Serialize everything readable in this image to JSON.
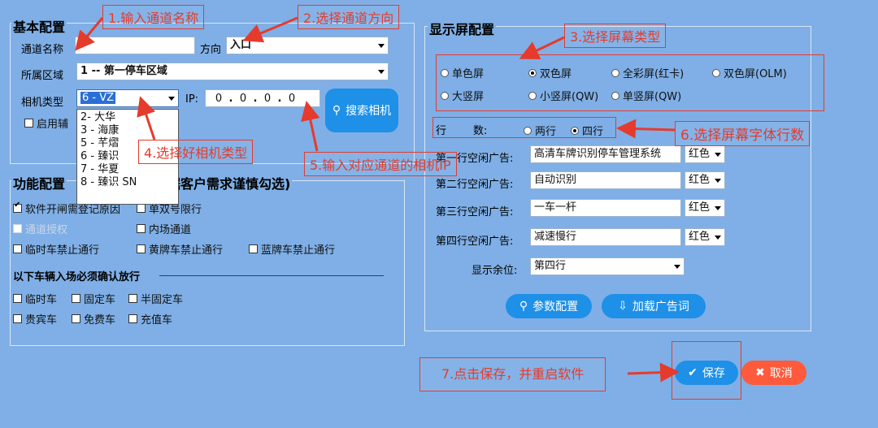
{
  "basic": {
    "title": "基本配置",
    "channel_name_label": "通道名称",
    "channel_name_value": "",
    "direction_label": "方向",
    "direction_value": "入口",
    "area_label": "所属区域",
    "area_value": "1 -- 第一停车区域",
    "camera_type_label": "相机类型",
    "camera_type_value": "6 -  VZ",
    "camera_options": [
      "2-   大华",
      "3 -  海康",
      "5 -  芊熠",
      "6 -  臻识",
      "7 -  华夏",
      "8 -  臻识 SN"
    ],
    "ip_label": "IP:",
    "ip_parts": [
      "0",
      "0",
      "0",
      "0"
    ],
    "search_camera_label": "搜索相机",
    "enable_aux_label": "启用辅"
  },
  "function": {
    "title_left": "功能配置",
    "title_right": "据客户需求谨慎勾选)",
    "options": [
      {
        "label": "软件开闸需登记原因",
        "checked": true
      },
      {
        "label": "单双号限行",
        "checked": false
      },
      {
        "label": "通道授权",
        "checked": false
      },
      {
        "label": "内场通道",
        "checked": false
      },
      {
        "label": "临时车禁止通行",
        "checked": false
      },
      {
        "label": "黄牌车禁止通行",
        "checked": false
      },
      {
        "label": "蓝牌车禁止通行",
        "checked": false
      }
    ],
    "confirm_title": "以下车辆入场必须确认放行",
    "confirm_options": [
      "临时车",
      "固定车",
      "半固定车",
      "贵宾车",
      "免费车",
      "充值车"
    ]
  },
  "display": {
    "title": "显示屏配置",
    "screen_types": [
      {
        "label": "单色屏",
        "on": false
      },
      {
        "label": "双色屏",
        "on": true
      },
      {
        "label": "全彩屏(红卡)",
        "on": false
      },
      {
        "label": "双色屏(OLM)",
        "on": false
      },
      {
        "label": "大竖屏",
        "on": false
      },
      {
        "label": "小竖屏(QW)",
        "on": false
      },
      {
        "label": "单竖屏(QW)",
        "on": false
      }
    ],
    "rows_label": "行        数:",
    "rows_options": [
      {
        "label": "两行",
        "on": false
      },
      {
        "label": "四行",
        "on": true
      }
    ],
    "ad_lines": [
      {
        "label": "第一行空闲广告:",
        "text": "高清车牌识别停车管理系统",
        "color": "红色"
      },
      {
        "label": "第二行空闲广告:",
        "text": "自动识别",
        "color": "红色"
      },
      {
        "label": "第三行空闲广告:",
        "text": "一车一杆",
        "color": "红色"
      },
      {
        "label": "第四行空闲广告:",
        "text": "减速慢行",
        "color": "红色"
      }
    ],
    "remaining_label": "显示余位:",
    "remaining_value": "第四行",
    "param_button": "参数配置",
    "load_ads_button": "加载广告词"
  },
  "actions": {
    "save": "保存",
    "cancel": "取消"
  },
  "annotations": {
    "n1": "1.输入通道名称",
    "n2": "2.选择通道方向",
    "n3": "3.选择屏幕类型",
    "n4": "4.选择好相机类型",
    "n5": "5.输入对应通道的相机IP",
    "n6": "6.选择屏幕字体行数",
    "n7": "7.点击保存，并重启软件"
  },
  "colors": {
    "background": "#7FAFE6",
    "annotation_red": "#E53B2C",
    "button_blue": "#1E90E8",
    "cancel_red": "#FF5A3C"
  }
}
